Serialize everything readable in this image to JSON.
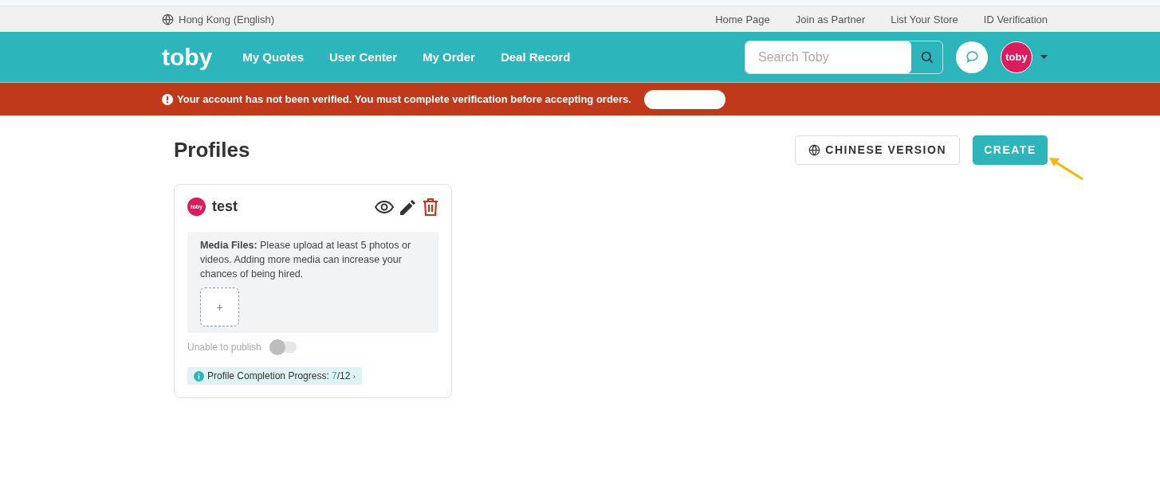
{
  "topbar": {
    "region": "Hong Kong (English)",
    "links": [
      "Home Page",
      "Join as Partner",
      "List Your Store",
      "ID Verification"
    ]
  },
  "nav": {
    "logo": "toby",
    "items": [
      "My Quotes",
      "User Center",
      "My Order",
      "Deal Record"
    ],
    "search": {
      "placeholder": "Search Toby"
    },
    "avatar": "toby"
  },
  "alert": {
    "message": "Your account has not been verified. You must complete verification before accepting orders."
  },
  "page": {
    "title": "Profiles",
    "language_button": "CHINESE VERSION",
    "create_button": "CREATE"
  },
  "profiles": [
    {
      "avatar": "toby",
      "name": "test",
      "media_note": "**Media Files:** Please upload at least 5 photos or videos. Adding more media can increase your chances of being hired.",
      "add_label": "+",
      "publish_label": "Unable to publish",
      "publish_on": false,
      "progress_label": "Profile Completion Progress:",
      "progress_done": "7",
      "progress_total": "/12",
      "progress_chevron": "›"
    }
  ]
}
